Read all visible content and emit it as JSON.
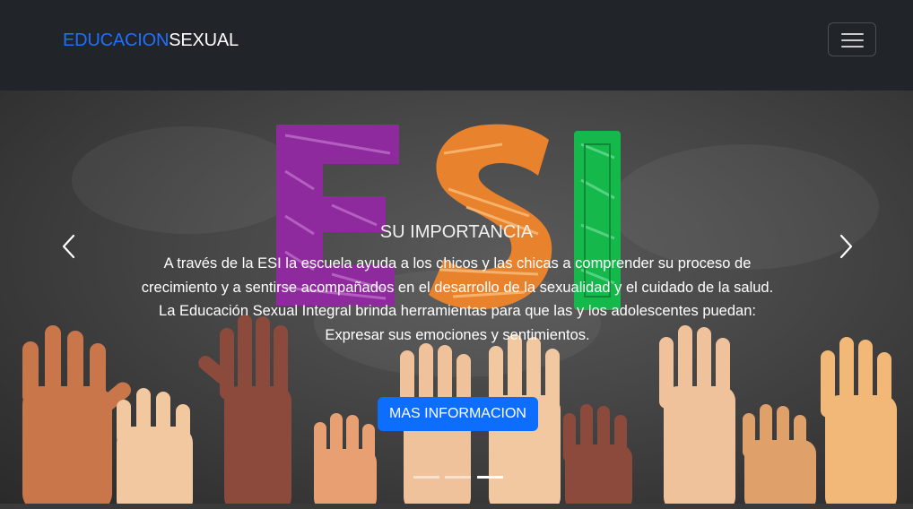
{
  "brand": {
    "part1": "EDUCACION",
    "part2": "SEXUAL",
    "color1": "#1f6fff",
    "color2": "#ffffff"
  },
  "navbar": {
    "toggler_icon": "hamburger-icon",
    "background": "#212529"
  },
  "hero": {
    "image_letters": [
      "E",
      "S",
      "I"
    ],
    "letter_colors": [
      "#8e2a9d",
      "#e8822d",
      "#14b84b"
    ],
    "hand_colors": [
      "#c8764a",
      "#f1c8a0",
      "#8b4a3c",
      "#f0c29c",
      "#e0a06a"
    ]
  },
  "slide": {
    "title": "SU IMPORTANCIA",
    "text": "A través de la ESI la escuela ayuda a los chicos y las chicas a comprender su proceso de crecimiento y a sentirse acompañados en el desarrollo de la sexualidad y el cuidado de la salud. La Educación Sexual Integral brinda herramientas para que las y los adolescentes puedan: Expresar sus emociones y sentimientos.",
    "button_label": "MAS INFORMACION",
    "button_color": "#0d6efd"
  },
  "controls": {
    "prev_icon": "chevron-left-icon",
    "next_icon": "chevron-right-icon"
  },
  "indicators": {
    "count": 3,
    "active_index": 2
  }
}
